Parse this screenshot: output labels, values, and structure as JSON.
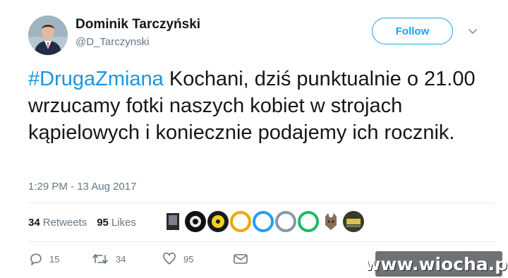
{
  "author": {
    "name": "Dominik Tarczyński",
    "handle": "@D_Tarczynski"
  },
  "header": {
    "follow_label": "Follow",
    "more_icon": "chevron-down-icon"
  },
  "tweet": {
    "hashtag": "#DrugaZmiana",
    "body": " Kochani, dziś punktualnie o 21.00 wrzucamy fotki naszych kobiet w strojach kąpielowych i koniecznie podajemy ich rocznik.",
    "timestamp": "1:29 PM - 13 Aug 2017"
  },
  "stats": {
    "retweets_count": "34",
    "retweets_label": "Retweets",
    "likes_count": "95",
    "likes_label": "Likes"
  },
  "actions": {
    "reply_count": "15",
    "retweet_count": "34",
    "like_count": "95"
  },
  "watermark": "www.wiocha.pl",
  "colors": {
    "link": "#1b95e0",
    "follow": "#1da1f2",
    "secondary": "#657786"
  }
}
